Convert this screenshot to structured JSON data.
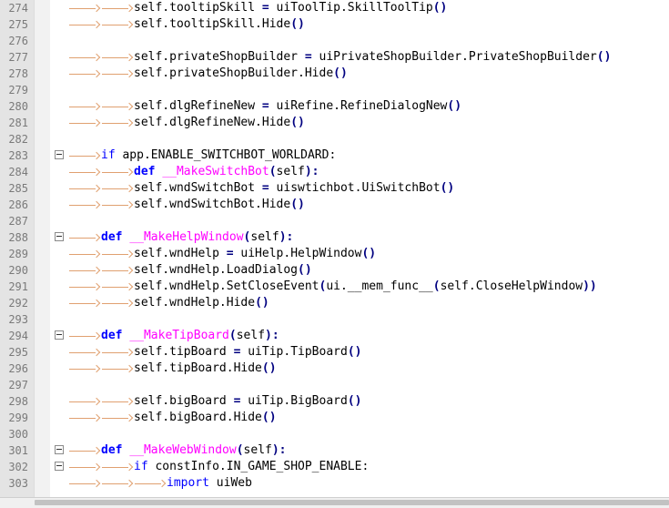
{
  "editor": {
    "lines": [
      {
        "num": "274",
        "indent": 2,
        "fold": false,
        "tokens": [
          [
            "tx",
            "self.tooltipSkill "
          ],
          [
            "op",
            "="
          ],
          [
            "tx",
            " uiToolTip.SkillToolTip"
          ],
          [
            "op",
            "()"
          ]
        ]
      },
      {
        "num": "275",
        "indent": 2,
        "fold": false,
        "tokens": [
          [
            "tx",
            "self.tooltipSkill.Hide"
          ],
          [
            "op",
            "()"
          ]
        ]
      },
      {
        "num": "276",
        "indent": 0,
        "fold": false,
        "tokens": []
      },
      {
        "num": "277",
        "indent": 2,
        "fold": false,
        "tokens": [
          [
            "tx",
            "self.privateShopBuilder "
          ],
          [
            "op",
            "="
          ],
          [
            "tx",
            " uiPrivateShopBuilder.PrivateShopBuilder"
          ],
          [
            "op",
            "()"
          ]
        ]
      },
      {
        "num": "278",
        "indent": 2,
        "fold": false,
        "tokens": [
          [
            "tx",
            "self.privateShopBuilder.Hide"
          ],
          [
            "op",
            "()"
          ]
        ]
      },
      {
        "num": "279",
        "indent": 0,
        "fold": false,
        "tokens": []
      },
      {
        "num": "280",
        "indent": 2,
        "fold": false,
        "tokens": [
          [
            "tx",
            "self.dlgRefineNew "
          ],
          [
            "op",
            "="
          ],
          [
            "tx",
            " uiRefine.RefineDialogNew"
          ],
          [
            "op",
            "()"
          ]
        ]
      },
      {
        "num": "281",
        "indent": 2,
        "fold": false,
        "tokens": [
          [
            "tx",
            "self.dlgRefineNew.Hide"
          ],
          [
            "op",
            "()"
          ]
        ]
      },
      {
        "num": "282",
        "indent": 0,
        "fold": false,
        "tokens": []
      },
      {
        "num": "283",
        "indent": 1,
        "fold": true,
        "tokens": [
          [
            "kw",
            "if"
          ],
          [
            "tx",
            " app.ENABLE_SWITCHBOT_WORLDARD:"
          ]
        ]
      },
      {
        "num": "284",
        "indent": 2,
        "fold": false,
        "tokens": [
          [
            "kwb",
            "def"
          ],
          [
            "tx",
            " "
          ],
          [
            "fn",
            "__MakeSwitchBot"
          ],
          [
            "op",
            "("
          ],
          [
            "tx",
            "self"
          ],
          [
            "op",
            "):"
          ]
        ]
      },
      {
        "num": "285",
        "indent": 2,
        "fold": false,
        "tokens": [
          [
            "tx",
            "self.wndSwitchBot "
          ],
          [
            "op",
            "="
          ],
          [
            "tx",
            " uiswtichbot.UiSwitchBot"
          ],
          [
            "op",
            "()"
          ]
        ]
      },
      {
        "num": "286",
        "indent": 2,
        "fold": false,
        "tokens": [
          [
            "tx",
            "self.wndSwitchBot.Hide"
          ],
          [
            "op",
            "()"
          ]
        ]
      },
      {
        "num": "287",
        "indent": 0,
        "fold": false,
        "tokens": []
      },
      {
        "num": "288",
        "indent": 1,
        "fold": true,
        "tokens": [
          [
            "kwb",
            "def"
          ],
          [
            "tx",
            " "
          ],
          [
            "fn",
            "__MakeHelpWindow"
          ],
          [
            "op",
            "("
          ],
          [
            "tx",
            "self"
          ],
          [
            "op",
            "):"
          ]
        ]
      },
      {
        "num": "289",
        "indent": 2,
        "fold": false,
        "tokens": [
          [
            "tx",
            "self.wndHelp "
          ],
          [
            "op",
            "="
          ],
          [
            "tx",
            " uiHelp.HelpWindow"
          ],
          [
            "op",
            "()"
          ]
        ]
      },
      {
        "num": "290",
        "indent": 2,
        "fold": false,
        "tokens": [
          [
            "tx",
            "self.wndHelp.LoadDialog"
          ],
          [
            "op",
            "()"
          ]
        ]
      },
      {
        "num": "291",
        "indent": 2,
        "fold": false,
        "tokens": [
          [
            "tx",
            "self.wndHelp.SetCloseEvent"
          ],
          [
            "op",
            "("
          ],
          [
            "tx",
            "ui.__mem_func__"
          ],
          [
            "op",
            "("
          ],
          [
            "tx",
            "self.CloseHelpWindow"
          ],
          [
            "op",
            "))"
          ]
        ]
      },
      {
        "num": "292",
        "indent": 2,
        "fold": false,
        "tokens": [
          [
            "tx",
            "self.wndHelp.Hide"
          ],
          [
            "op",
            "()"
          ]
        ]
      },
      {
        "num": "293",
        "indent": 0,
        "fold": false,
        "tokens": []
      },
      {
        "num": "294",
        "indent": 1,
        "fold": true,
        "tokens": [
          [
            "kwb",
            "def"
          ],
          [
            "tx",
            " "
          ],
          [
            "fn",
            "__MakeTipBoard"
          ],
          [
            "op",
            "("
          ],
          [
            "tx",
            "self"
          ],
          [
            "op",
            "):"
          ]
        ]
      },
      {
        "num": "295",
        "indent": 2,
        "fold": false,
        "tokens": [
          [
            "tx",
            "self.tipBoard "
          ],
          [
            "op",
            "="
          ],
          [
            "tx",
            " uiTip.TipBoard"
          ],
          [
            "op",
            "()"
          ]
        ]
      },
      {
        "num": "296",
        "indent": 2,
        "fold": false,
        "tokens": [
          [
            "tx",
            "self.tipBoard.Hide"
          ],
          [
            "op",
            "()"
          ]
        ]
      },
      {
        "num": "297",
        "indent": 0,
        "fold": false,
        "tokens": []
      },
      {
        "num": "298",
        "indent": 2,
        "fold": false,
        "tokens": [
          [
            "tx",
            "self.bigBoard "
          ],
          [
            "op",
            "="
          ],
          [
            "tx",
            " uiTip.BigBoard"
          ],
          [
            "op",
            "()"
          ]
        ]
      },
      {
        "num": "299",
        "indent": 2,
        "fold": false,
        "tokens": [
          [
            "tx",
            "self.bigBoard.Hide"
          ],
          [
            "op",
            "()"
          ]
        ]
      },
      {
        "num": "300",
        "indent": 0,
        "fold": false,
        "tokens": []
      },
      {
        "num": "301",
        "indent": 1,
        "fold": true,
        "tokens": [
          [
            "kwb",
            "def"
          ],
          [
            "tx",
            " "
          ],
          [
            "fn",
            "__MakeWebWindow"
          ],
          [
            "op",
            "("
          ],
          [
            "tx",
            "self"
          ],
          [
            "op",
            "):"
          ]
        ]
      },
      {
        "num": "302",
        "indent": 2,
        "fold": true,
        "tokens": [
          [
            "kw",
            "if"
          ],
          [
            "tx",
            " constInfo.IN_GAME_SHOP_ENABLE:"
          ]
        ]
      },
      {
        "num": "303",
        "indent": 3,
        "fold": false,
        "tokens": [
          [
            "kw",
            "import"
          ],
          [
            "tx",
            " uiWeb"
          ]
        ]
      }
    ]
  },
  "colors": {
    "keyword": "#0000ff",
    "function": "#ff00ff",
    "operator": "#000080",
    "text": "#000000",
    "tab_arrow": "#e0a070",
    "gutter": "#e4e4e4",
    "line_number": "#7a7a7a"
  },
  "icons": {
    "fold": "fold-minus-icon",
    "tab": "tab-arrow-icon"
  }
}
